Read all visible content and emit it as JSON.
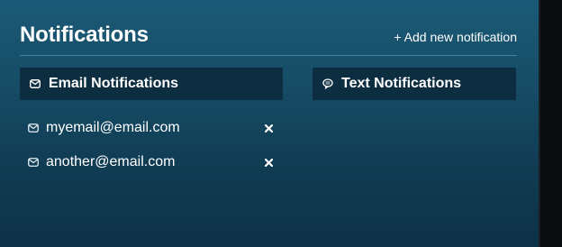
{
  "header": {
    "title": "Notifications",
    "add_label": "+ Add new notification"
  },
  "sections": {
    "email": {
      "label": "Email Notifications",
      "icon": "envelope-icon"
    },
    "text": {
      "label": "Text Notifications",
      "icon": "chat-bubble-icon"
    }
  },
  "email_list": [
    {
      "address": "myemail@email.com",
      "icon": "envelope-icon",
      "remove_icon": "close-icon"
    },
    {
      "address": "another@email.com",
      "icon": "envelope-icon",
      "remove_icon": "close-icon"
    }
  ],
  "colors": {
    "panel_top": "#1b5a77",
    "panel_bottom": "#0d3147",
    "section_bg": "#0d2e40",
    "divider": "#3f88a5",
    "text": "#ffffff"
  }
}
